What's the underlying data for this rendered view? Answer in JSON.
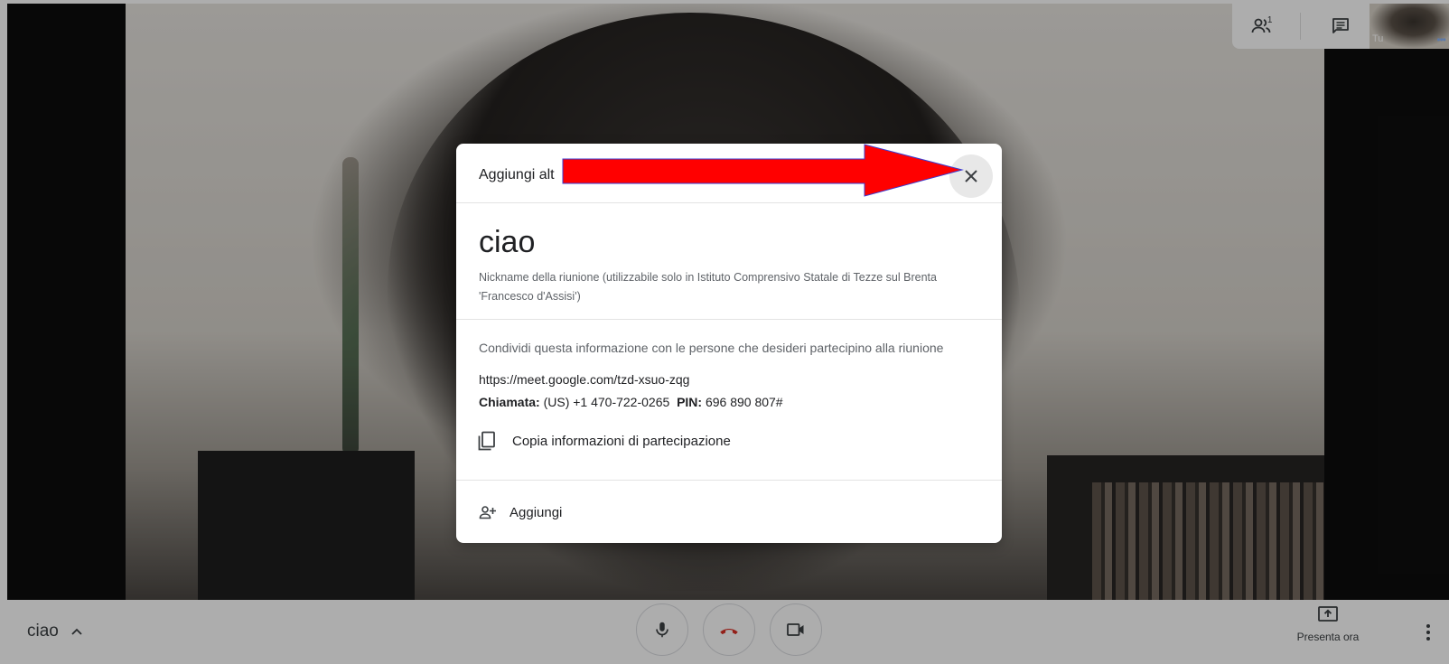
{
  "dialog": {
    "title": "Aggiungi alt",
    "close_icon": "close-icon",
    "meeting_name": "ciao",
    "nickname_note": "Nickname della riunione (utilizzabile solo in Istituto Comprensivo Statale di Tezze sul Brenta 'Francesco d'Assisi')",
    "share_description": "Condividi questa informazione con le persone che desideri partecipino alla riunione",
    "meeting_link": "https://meet.google.com/tzd-xsuo-zqg",
    "phone": {
      "call_label": "Chiamata:",
      "number": "(US) +1 470-722-0265",
      "pin_label": "PIN:",
      "pin": "696 890 807#"
    },
    "copy_button_label": "Copia informazioni di partecipazione",
    "add_button_label": "Aggiungi"
  },
  "top_controls": {
    "people_count": "1",
    "people_icon": "people-icon",
    "chat_icon": "chat-icon",
    "self_view_label": "Tu"
  },
  "bottom_bar": {
    "meeting_title": "ciao",
    "present_label": "Presenta ora",
    "icons": [
      "chevron-up-icon",
      "microphone-icon",
      "hang-up-icon",
      "camera-icon",
      "present-icon",
      "more-vert-icon"
    ]
  },
  "colors": {
    "hangup_red": "#d93025",
    "annotation_red": "#ff0000"
  }
}
